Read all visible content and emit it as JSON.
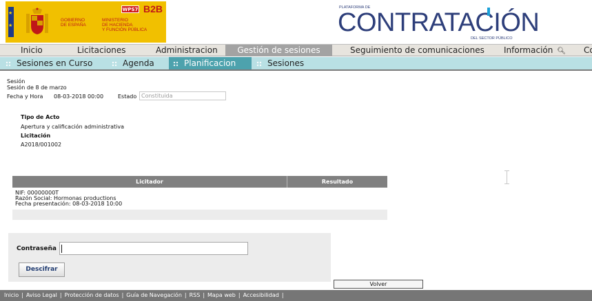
{
  "header": {
    "gov_line1": "GOBIERNO",
    "gov_line2": "DE ESPAÑA",
    "min_line1": "MINISTERIO",
    "min_line2": "DE HACIENDA",
    "min_line3": "Y FUNCIÓN PÚBLICA",
    "wps_badge": "WPS7",
    "b2b": "B2B",
    "plat_small": "PLATAFORMA DE",
    "plat_big": "CONTRATACIÓN",
    "plat_sub": "DEL SECTOR PÚBLICO",
    "colors": {
      "gov_yellow": "#f1c000",
      "gov_red": "#c01818",
      "plat_blue": "#2d3e7a",
      "plat_accent": "#1aa0d8"
    }
  },
  "main_nav": {
    "items": [
      "Inicio",
      "Licitaciones",
      "Administracion",
      "Gestión de sesiones",
      "Seguimiento de comunicaciones",
      "Información",
      "Co"
    ],
    "active": "Gestión de sesiones",
    "search_icon": "search-icon"
  },
  "sub_nav": {
    "items": [
      "Sesiones en Curso",
      "Agenda",
      "Planificacion",
      "Sesiones"
    ],
    "active": "Planificacion",
    "colors": {
      "bar": "#b9e0e4",
      "active": "#4da2ad"
    }
  },
  "session": {
    "title": "Sesión",
    "name": "Sesión de 8 de marzo",
    "fecha_label": "Fecha y Hora",
    "fecha_value": "08-03-2018 00:00",
    "estado_label": "Estado",
    "estado_value": "Constituida"
  },
  "acto": {
    "tipo_label": "Tipo de Acto",
    "tipo_value": "Apertura y calificación administrativa",
    "licitacion_label": "Licitación",
    "licitacion_value": "A2018/001002"
  },
  "table": {
    "headers": [
      "Licitador",
      "Resultado"
    ],
    "rows": [
      {
        "nif": "NIF: 00000000T",
        "razon": "Razón Social: Hormonas productions",
        "fecha": "Fecha presentación: 08-03-2018 10:00",
        "resultado": ""
      }
    ]
  },
  "password": {
    "label": "Contraseña",
    "value": "",
    "button": "Descifrar"
  },
  "volver_button": "Volver",
  "footer": {
    "links": [
      "Inicio",
      "Aviso Legal",
      "Protección de datos",
      "Guía de Navegación",
      "RSS",
      "Mapa web",
      "Accesibilidad"
    ],
    "separator": "|"
  }
}
